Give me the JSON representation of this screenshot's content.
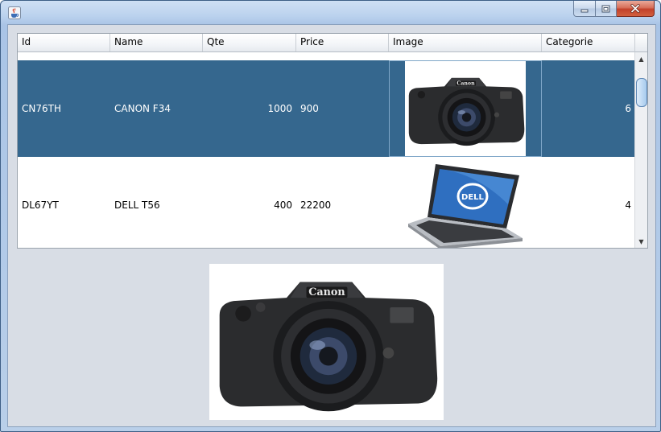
{
  "window": {
    "app_icon": "java-cup-icon",
    "controls": [
      "minimize-icon",
      "maximize-icon",
      "close-icon"
    ]
  },
  "table": {
    "columns": [
      "Id",
      "Name",
      "Qte",
      "Price",
      "Image",
      "Categorie"
    ],
    "rows": [
      {
        "id": "CN76TH",
        "name": "CANON F34",
        "qte": "1000",
        "price": "900",
        "image": "camera-image",
        "categorie": "6",
        "selected": true
      },
      {
        "id": "DL67YT",
        "name": "DELL T56",
        "qte": "400",
        "price": "22200",
        "image": "laptop-image",
        "categorie": "4",
        "selected": false
      }
    ]
  },
  "preview": {
    "image": "camera-image"
  },
  "colors": {
    "selection": "#35678e",
    "panel": "#d8dde5"
  }
}
